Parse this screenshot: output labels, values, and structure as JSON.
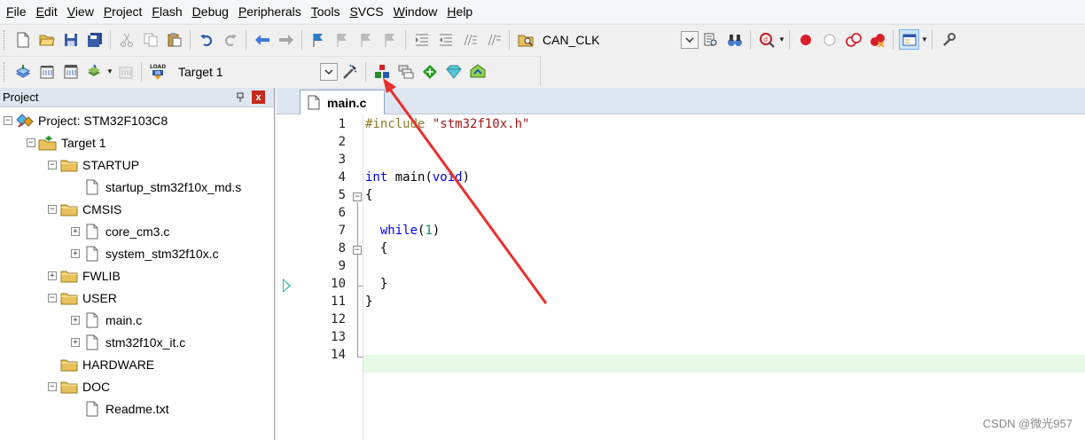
{
  "menu": [
    "File",
    "Edit",
    "View",
    "Project",
    "Flash",
    "Debug",
    "Peripherals",
    "Tools",
    "SVCS",
    "Window",
    "Help"
  ],
  "toolbar1": {
    "find_combo_value": "CAN_CLK"
  },
  "toolbar2": {
    "target_combo_value": "Target 1",
    "load_label": "LOAD"
  },
  "project_panel": {
    "title": "Project",
    "pin": "ᵖ",
    "close": "x",
    "tree": [
      {
        "label": "Project: STM32F103C8",
        "level": 0,
        "type": "project",
        "expander": "−"
      },
      {
        "label": "Target 1",
        "level": 1,
        "type": "target",
        "expander": "−"
      },
      {
        "label": "STARTUP",
        "level": 2,
        "type": "folder",
        "expander": "−"
      },
      {
        "label": "startup_stm32f10x_md.s",
        "level": 3,
        "type": "file",
        "expander": ""
      },
      {
        "label": "CMSIS",
        "level": 2,
        "type": "folder",
        "expander": "−"
      },
      {
        "label": "core_cm3.c",
        "level": 3,
        "type": "file",
        "expander": "+"
      },
      {
        "label": "system_stm32f10x.c",
        "level": 3,
        "type": "file",
        "expander": "+"
      },
      {
        "label": "FWLIB",
        "level": 2,
        "type": "folder",
        "expander": "+"
      },
      {
        "label": "USER",
        "level": 2,
        "type": "folder",
        "expander": "−"
      },
      {
        "label": "main.c",
        "level": 3,
        "type": "file",
        "expander": "+"
      },
      {
        "label": "stm32f10x_it.c",
        "level": 3,
        "type": "file",
        "expander": "+"
      },
      {
        "label": "HARDWARE",
        "level": 2,
        "type": "folder",
        "expander": ""
      },
      {
        "label": "DOC",
        "level": 2,
        "type": "folder",
        "expander": "−"
      },
      {
        "label": "Readme.txt",
        "level": 3,
        "type": "file",
        "expander": ""
      }
    ]
  },
  "editor": {
    "tab_label": "main.c",
    "lines": [
      {
        "n": "1",
        "pp": "#include",
        "rest": " ",
        "str": "\"stm32f10x.h\""
      },
      {
        "n": "2"
      },
      {
        "n": "3"
      },
      {
        "n": "4",
        "kw1": "int",
        "mid": " main(",
        "kw2": "void",
        "end": ")"
      },
      {
        "n": "5",
        "plain": "{"
      },
      {
        "n": "6"
      },
      {
        "n": "7",
        "indent": "  ",
        "kw1": "while",
        "mid": "(",
        "num": "1",
        "end": ")"
      },
      {
        "n": "8",
        "plain": "  {"
      },
      {
        "n": "9"
      },
      {
        "n": "10",
        "plain": "  }"
      },
      {
        "n": "11",
        "plain": "}"
      },
      {
        "n": "12"
      },
      {
        "n": "13"
      },
      {
        "n": "14"
      }
    ]
  },
  "watermark": "CSDN @微光957",
  "colors": {
    "keyword": "#0000ff",
    "string": "#a31515",
    "annotation_arrow": "#e8302a",
    "current_line": "#e6fae6"
  }
}
